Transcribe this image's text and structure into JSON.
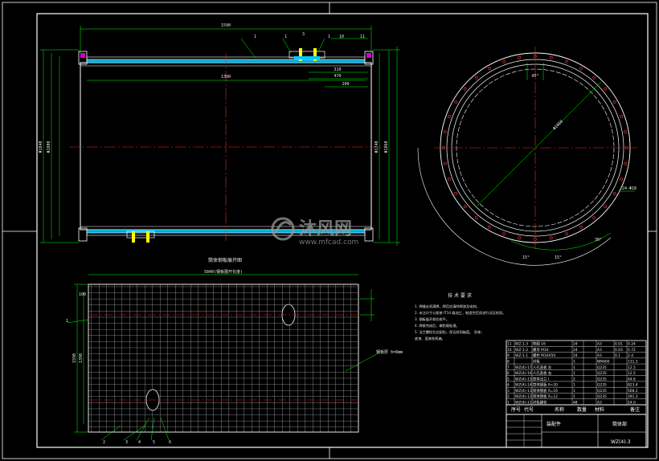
{
  "colors": {
    "background": "#000000",
    "outline": "#ffffff",
    "dimension": "#00ff00",
    "centerline": "#ff2020",
    "hatch": "#00c8ff",
    "bolt": "#ffff00",
    "watermark": "#9a9a9a"
  },
  "views": {
    "main": {
      "overall_length": "1590",
      "inner_length": "1390",
      "height_outer": "Φ1840",
      "height_inner": "Φ1800",
      "right_dim_a": "Φ1740",
      "right_dim_b": "Φ1860",
      "dim_small_1": "310",
      "dim_small_2": "470",
      "dim_small_3": "200",
      "balloons": [
        "1",
        "1",
        "3",
        "1",
        "10",
        "11"
      ]
    },
    "circle": {
      "diameter": "Φ1860",
      "angle_label": "45°",
      "hole_note": "24-Φ18",
      "arc_labels": [
        "15°",
        "15°",
        "30°"
      ]
    },
    "unfold": {
      "title": "筒体钢板展开图",
      "width_dim": "5840(钢板展开长度)",
      "left_balloon": "1",
      "right_note": "钢板厚 δ=8mm",
      "left_dims": [
        "1590",
        "1390",
        "100"
      ],
      "bottom_balloons": [
        "2",
        "3",
        "4",
        "5",
        "6"
      ]
    }
  },
  "notes": {
    "title": "技 术 要 求",
    "lines": [
      "1. 焊缝必须满焊，焊后应清除焊渣及毛刺。",
      "2. 未注尺寸公差按 IT14 级加工，制造完后须进行试压检验。",
      "3. 钢板展开前应校平。",
      "4. 焊接完成后，做防腐处理。",
      "5. 法兰螺栓孔应配钻，保证其同轴度。 涂漆；",
      "   底漆、面漆各两遍。"
    ]
  },
  "parts_table": {
    "rows": [
      [
        "11",
        "WZ-1-3",
        "垫圈 16",
        "24",
        "",
        "A3",
        "0.01",
        "0.24"
      ],
      [
        "10",
        "WZ-1-2",
        "螺母 M16",
        "24",
        "",
        "A3",
        "0.03",
        "0.72"
      ],
      [
        "9",
        "WZ-1-1",
        "螺栓 M16X50",
        "24",
        "",
        "A3",
        "0.1",
        "2.4"
      ],
      [
        "8",
        "",
        "衬板",
        "1",
        "",
        "NM400",
        "",
        "131.3"
      ],
      [
        "7",
        "WZ(4)-17",
        "人孔盖板 左",
        "1",
        "",
        "Q235",
        "",
        "12.5"
      ],
      [
        "6",
        "WZ(4)-16",
        "人孔盖板 右",
        "1",
        "",
        "Q235",
        "",
        "12.5"
      ],
      [
        "5",
        "WZ(4)-15",
        "筒体法兰 I",
        "2",
        "",
        "Q235",
        "",
        "44.6"
      ],
      [
        "4",
        "WZ(4)-14",
        "筒体钢板 δ=20",
        "1",
        "",
        "Q235",
        "",
        "823.4"
      ],
      [
        "3",
        "WZ(4)-13",
        "筒体钢板 δ=16",
        "1",
        "",
        "Q235",
        "",
        "568.2"
      ],
      [
        "2",
        "WZ(4)-12",
        "筒体钢板 δ=12",
        "1",
        "",
        "Q235",
        "",
        "391.3"
      ],
      [
        "1",
        "WZ(4)-11",
        "衬板螺栓",
        "48",
        "",
        "A3",
        "",
        "24.0"
      ]
    ],
    "header": [
      "序号",
      "代号",
      "名称",
      "数量",
      "材料",
      "备注"
    ]
  },
  "title_block": {
    "assembly_label": "装配件",
    "drawing_name": "筒体部",
    "drawing_code": "WZ(4)-3"
  },
  "watermark": {
    "brand": "沐风网",
    "url": "www.mfcad.com"
  }
}
